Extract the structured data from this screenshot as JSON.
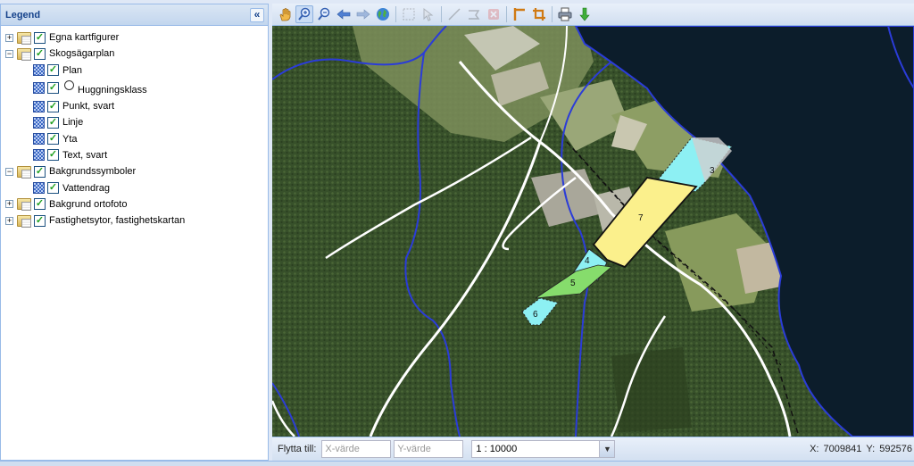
{
  "legend": {
    "title": "Legend",
    "collapse_glyph": "«",
    "items": [
      {
        "label": "Egna kartfigurer",
        "checked": true
      },
      {
        "label": "Skogsägarplan",
        "checked": true
      },
      {
        "label": "Plan",
        "checked": true
      },
      {
        "label": "Huggningsklass",
        "checked": true
      },
      {
        "label": "Punkt, svart",
        "checked": true
      },
      {
        "label": "Linje",
        "checked": true
      },
      {
        "label": "Yta",
        "checked": true
      },
      {
        "label": "Text, svart",
        "checked": true
      },
      {
        "label": "Bakgrundssymboler",
        "checked": true
      },
      {
        "label": "Vattendrag",
        "checked": true
      },
      {
        "label": "Bakgrund ortofoto",
        "checked": true
      },
      {
        "label": "Fastighetsytor, fastighetskartan",
        "checked": true
      }
    ]
  },
  "toolbar": {
    "icons": [
      "pan-hand-icon",
      "zoom-in-icon",
      "zoom-out-icon",
      "back-arrow-icon",
      "forward-arrow-icon",
      "globe-full-extent-icon",
      "select-disabled-icon",
      "info-disabled-icon",
      "measure-line-disabled-icon",
      "measure-area-disabled-icon",
      "clear-disabled-icon",
      "draw-line-icon",
      "crop-icon",
      "print-icon",
      "download-icon"
    ]
  },
  "map": {
    "stand_labels": [
      "3",
      "7",
      "4",
      "5",
      "6"
    ],
    "colors": {
      "stand_yellow": "#fbf08c",
      "stand_cyan": "#8df0f3",
      "stand_green": "#86dc6c",
      "water": "#0c1d2b",
      "stream": "#2b3cd8"
    }
  },
  "bottom": {
    "goto_label": "Flytta till:",
    "x_placeholder": "X-värde",
    "y_placeholder": "Y-värde",
    "scale_value": "1 : 10000",
    "x_label": "X:",
    "x_value": "7009841",
    "y_label": "Y:",
    "y_value": "592576"
  }
}
